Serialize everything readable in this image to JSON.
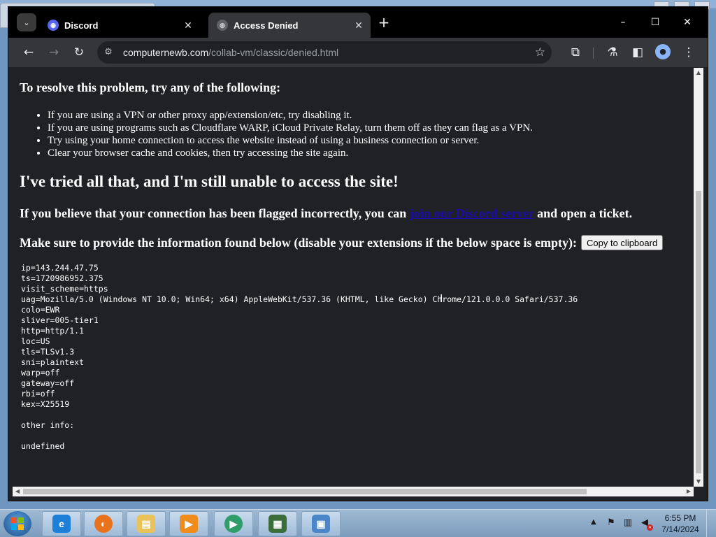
{
  "browser": {
    "tabs": [
      {
        "title": "Discord",
        "icon": "discord-icon",
        "active": false
      },
      {
        "title": "Access Denied",
        "icon": "globe-icon",
        "active": true
      }
    ],
    "address": {
      "host": "computernewb.com",
      "path": "/collab-vm/classic/denied.html"
    },
    "window_controls": {
      "minimize": "–",
      "maximize": "☐",
      "close": "✕"
    }
  },
  "page": {
    "resolve_heading": "To resolve this problem, try any of the following:",
    "tips": [
      "If you are using a VPN or other proxy app/extension/etc, try disabling it.",
      "If you are using programs such as Cloudflare WARP, iCloud Private Relay, turn them off as they can flag as a VPN.",
      "Try using your home connection to access the website instead of using a business connection or server.",
      "Clear your browser cache and cookies, then try accessing the site again."
    ],
    "tried_heading": "I've tried all that, and I'm still unable to access the site!",
    "flag_text_before": "If you believe that your connection has been flagged incorrectly, you can ",
    "flag_link": "join our Discord server",
    "flag_text_after": " and open a ticket.",
    "provide_text": "Make sure to provide the information found below (disable your extensions if the below space is empty):",
    "copy_button": "Copy to clipboard",
    "info_lines": [
      "ip=143.244.47.75",
      "ts=1720986952.375",
      "visit_scheme=https",
      "uag=Mozilla/5.0 (Windows NT 10.0; Win64; x64) AppleWebKit/537.36 (KHTML, like Gecko) Chrome/121.0.0.0 Safari/537.36",
      "colo=EWR",
      "sliver=005-tier1",
      "http=http/1.1",
      "loc=US",
      "tls=TLSv1.3",
      "sni=plaintext",
      "warp=off",
      "gateway=off",
      "rbi=off",
      "kex=X25519",
      "",
      "other info:",
      "",
      "undefined"
    ]
  },
  "taskbar": {
    "apps": [
      "internet-explorer-icon",
      "firefox-icon",
      "file-explorer-icon",
      "media-player-icon",
      "media-center-icon",
      "task-manager-icon",
      "control-panel-icon"
    ],
    "clock_time": "6:55 PM",
    "clock_date": "7/14/2024"
  },
  "colors": {
    "page_bg": "#202124",
    "link": "#1a0dab",
    "tab_active": "#35363a",
    "tabbar": "#000000"
  }
}
